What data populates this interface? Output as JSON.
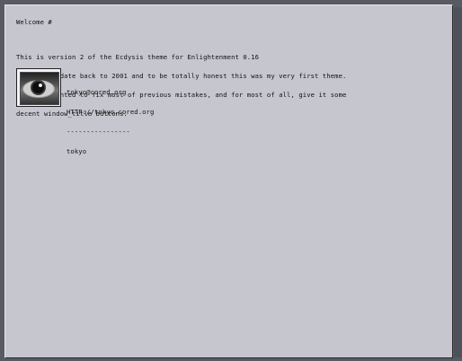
{
  "content": {
    "title": "Welcome #",
    "intro_lines": [
      "This is version 2 of the Ecdysis theme for Enlightenment 0.16",
      "It's roots date back to 2001 and to be totally honest this was my very first theme.",
      "I always wanted to fix most of previous mistakes, and for most of all, give it some",
      "decent window_title buttons."
    ],
    "contact_lines": [
      "tokyo@cored.org",
      "HTTP://tokyo.cored.org",
      "----------------",
      "tokyo"
    ]
  },
  "icons": {
    "avatar": "eye-avatar-icon"
  }
}
